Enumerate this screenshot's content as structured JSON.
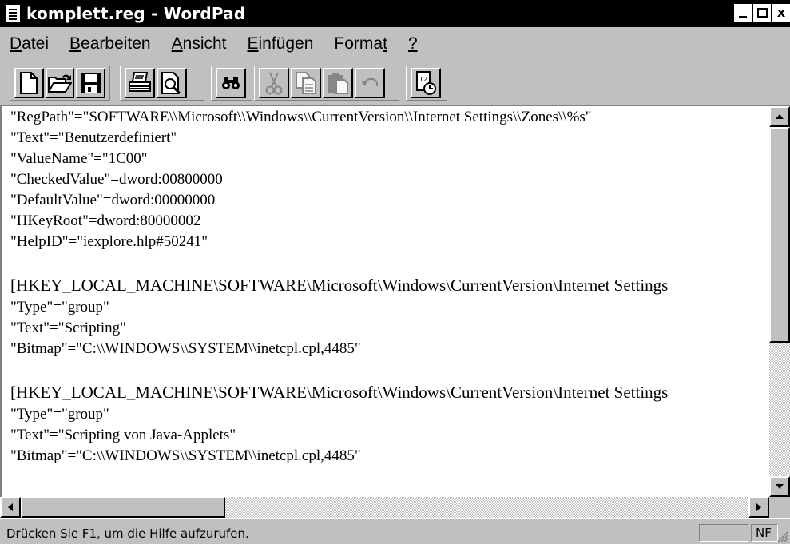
{
  "window": {
    "title": "komplett.reg - WordPad",
    "min_label": "_",
    "max_label": "□",
    "close_label": "x"
  },
  "menu": [
    {
      "accel": "D",
      "rest": "atei"
    },
    {
      "accel": "B",
      "rest": "earbeiten"
    },
    {
      "accel": "A",
      "rest": "nsicht"
    },
    {
      "accel": "E",
      "rest": "infügen"
    },
    {
      "pre": "Forma",
      "accel": "t",
      "rest": ""
    },
    {
      "accel": "?",
      "rest": ""
    }
  ],
  "toolbar": {
    "icons": [
      "new-icon",
      "open-icon",
      "save-icon",
      "print-icon",
      "print-preview-icon",
      "find-icon",
      "cut-icon",
      "copy-icon",
      "paste-icon",
      "undo-icon",
      "date-time-icon"
    ]
  },
  "document": {
    "lines": [
      "\"RegPath\"=\"SOFTWARE\\\\Microsoft\\\\Windows\\\\CurrentVersion\\\\Internet Settings\\\\Zones\\\\%s\"",
      "\"Text\"=\"Benutzerdefiniert\"",
      "\"ValueName\"=\"1C00\"",
      "\"CheckedValue\"=dword:00800000",
      "\"DefaultValue\"=dword:00000000",
      "\"HKeyRoot\"=dword:80000002",
      "\"HelpID\"=\"iexplore.hlp#50241\"",
      "",
      "[HKEY_LOCAL_MACHINE\\SOFTWARE\\Microsoft\\Windows\\CurrentVersion\\Internet Settings",
      "\"Type\"=\"group\"",
      "\"Text\"=\"Scripting\"",
      "\"Bitmap\"=\"C:\\\\WINDOWS\\\\SYSTEM\\\\inetcpl.cpl,4485\"",
      "",
      "[HKEY_LOCAL_MACHINE\\SOFTWARE\\Microsoft\\Windows\\CurrentVersion\\Internet Settings",
      "\"Type\"=\"group\"",
      "\"Text\"=\"Scripting von Java-Applets\"",
      "\"Bitmap\"=\"C:\\\\WINDOWS\\\\SYSTEM\\\\inetcpl.cpl,4485\""
    ]
  },
  "statusbar": {
    "text": "Drücken Sie F1, um die Hilfe aufzurufen.",
    "panel_2": "NF"
  }
}
